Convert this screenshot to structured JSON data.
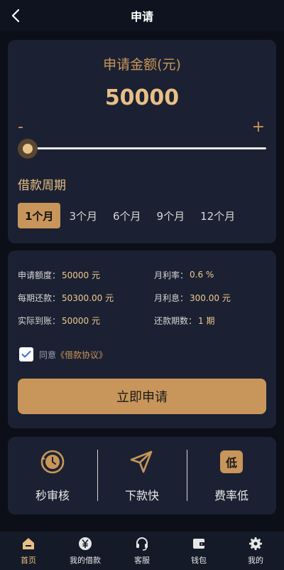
{
  "header": {
    "title": "申请"
  },
  "amount": {
    "label": "申请金额(元)",
    "value": "50000",
    "minus": "-",
    "plus": "+",
    "slider_level": 0
  },
  "period": {
    "title": "借款周期",
    "tabs": [
      "1个月",
      "3个月",
      "6个月",
      "9个月",
      "12个月"
    ],
    "selected": "1个月"
  },
  "info": {
    "rows": [
      [
        {
          "key": "申请额度：",
          "val": "50000 元"
        },
        {
          "key": "月利率：",
          "val": "0.6 %"
        }
      ],
      [
        {
          "key": "每期还款：",
          "val": "50300.00 元"
        },
        {
          "key": "月利息：",
          "val": "300.00 元"
        }
      ],
      [
        {
          "key": "实际到账：",
          "val": "50000 元"
        },
        {
          "key": "还款期数：",
          "val": "1 期"
        }
      ]
    ]
  },
  "agreement": {
    "checked": true,
    "prefix": "同意",
    "link": "《借款协议》"
  },
  "apply_button": "立即申请",
  "features": [
    {
      "icon": "clock-icon",
      "label": "秒审核"
    },
    {
      "icon": "send-icon",
      "label": "下款快"
    },
    {
      "icon": "low-rate-icon",
      "icon_text": "低",
      "label": "费率低"
    }
  ],
  "tabbar": [
    {
      "icon": "home-icon",
      "label": "首页",
      "active": true
    },
    {
      "icon": "yen-icon",
      "label": "我的借款",
      "active": false
    },
    {
      "icon": "headset-icon",
      "label": "客服",
      "active": false
    },
    {
      "icon": "wallet-icon",
      "label": "钱包",
      "active": false
    },
    {
      "icon": "gear-icon",
      "label": "我的",
      "active": false
    }
  ],
  "colors": {
    "accent": "#c8955a",
    "gold_text": "#e8bf86",
    "card": "#1b2132",
    "background": "#0c0f18"
  }
}
